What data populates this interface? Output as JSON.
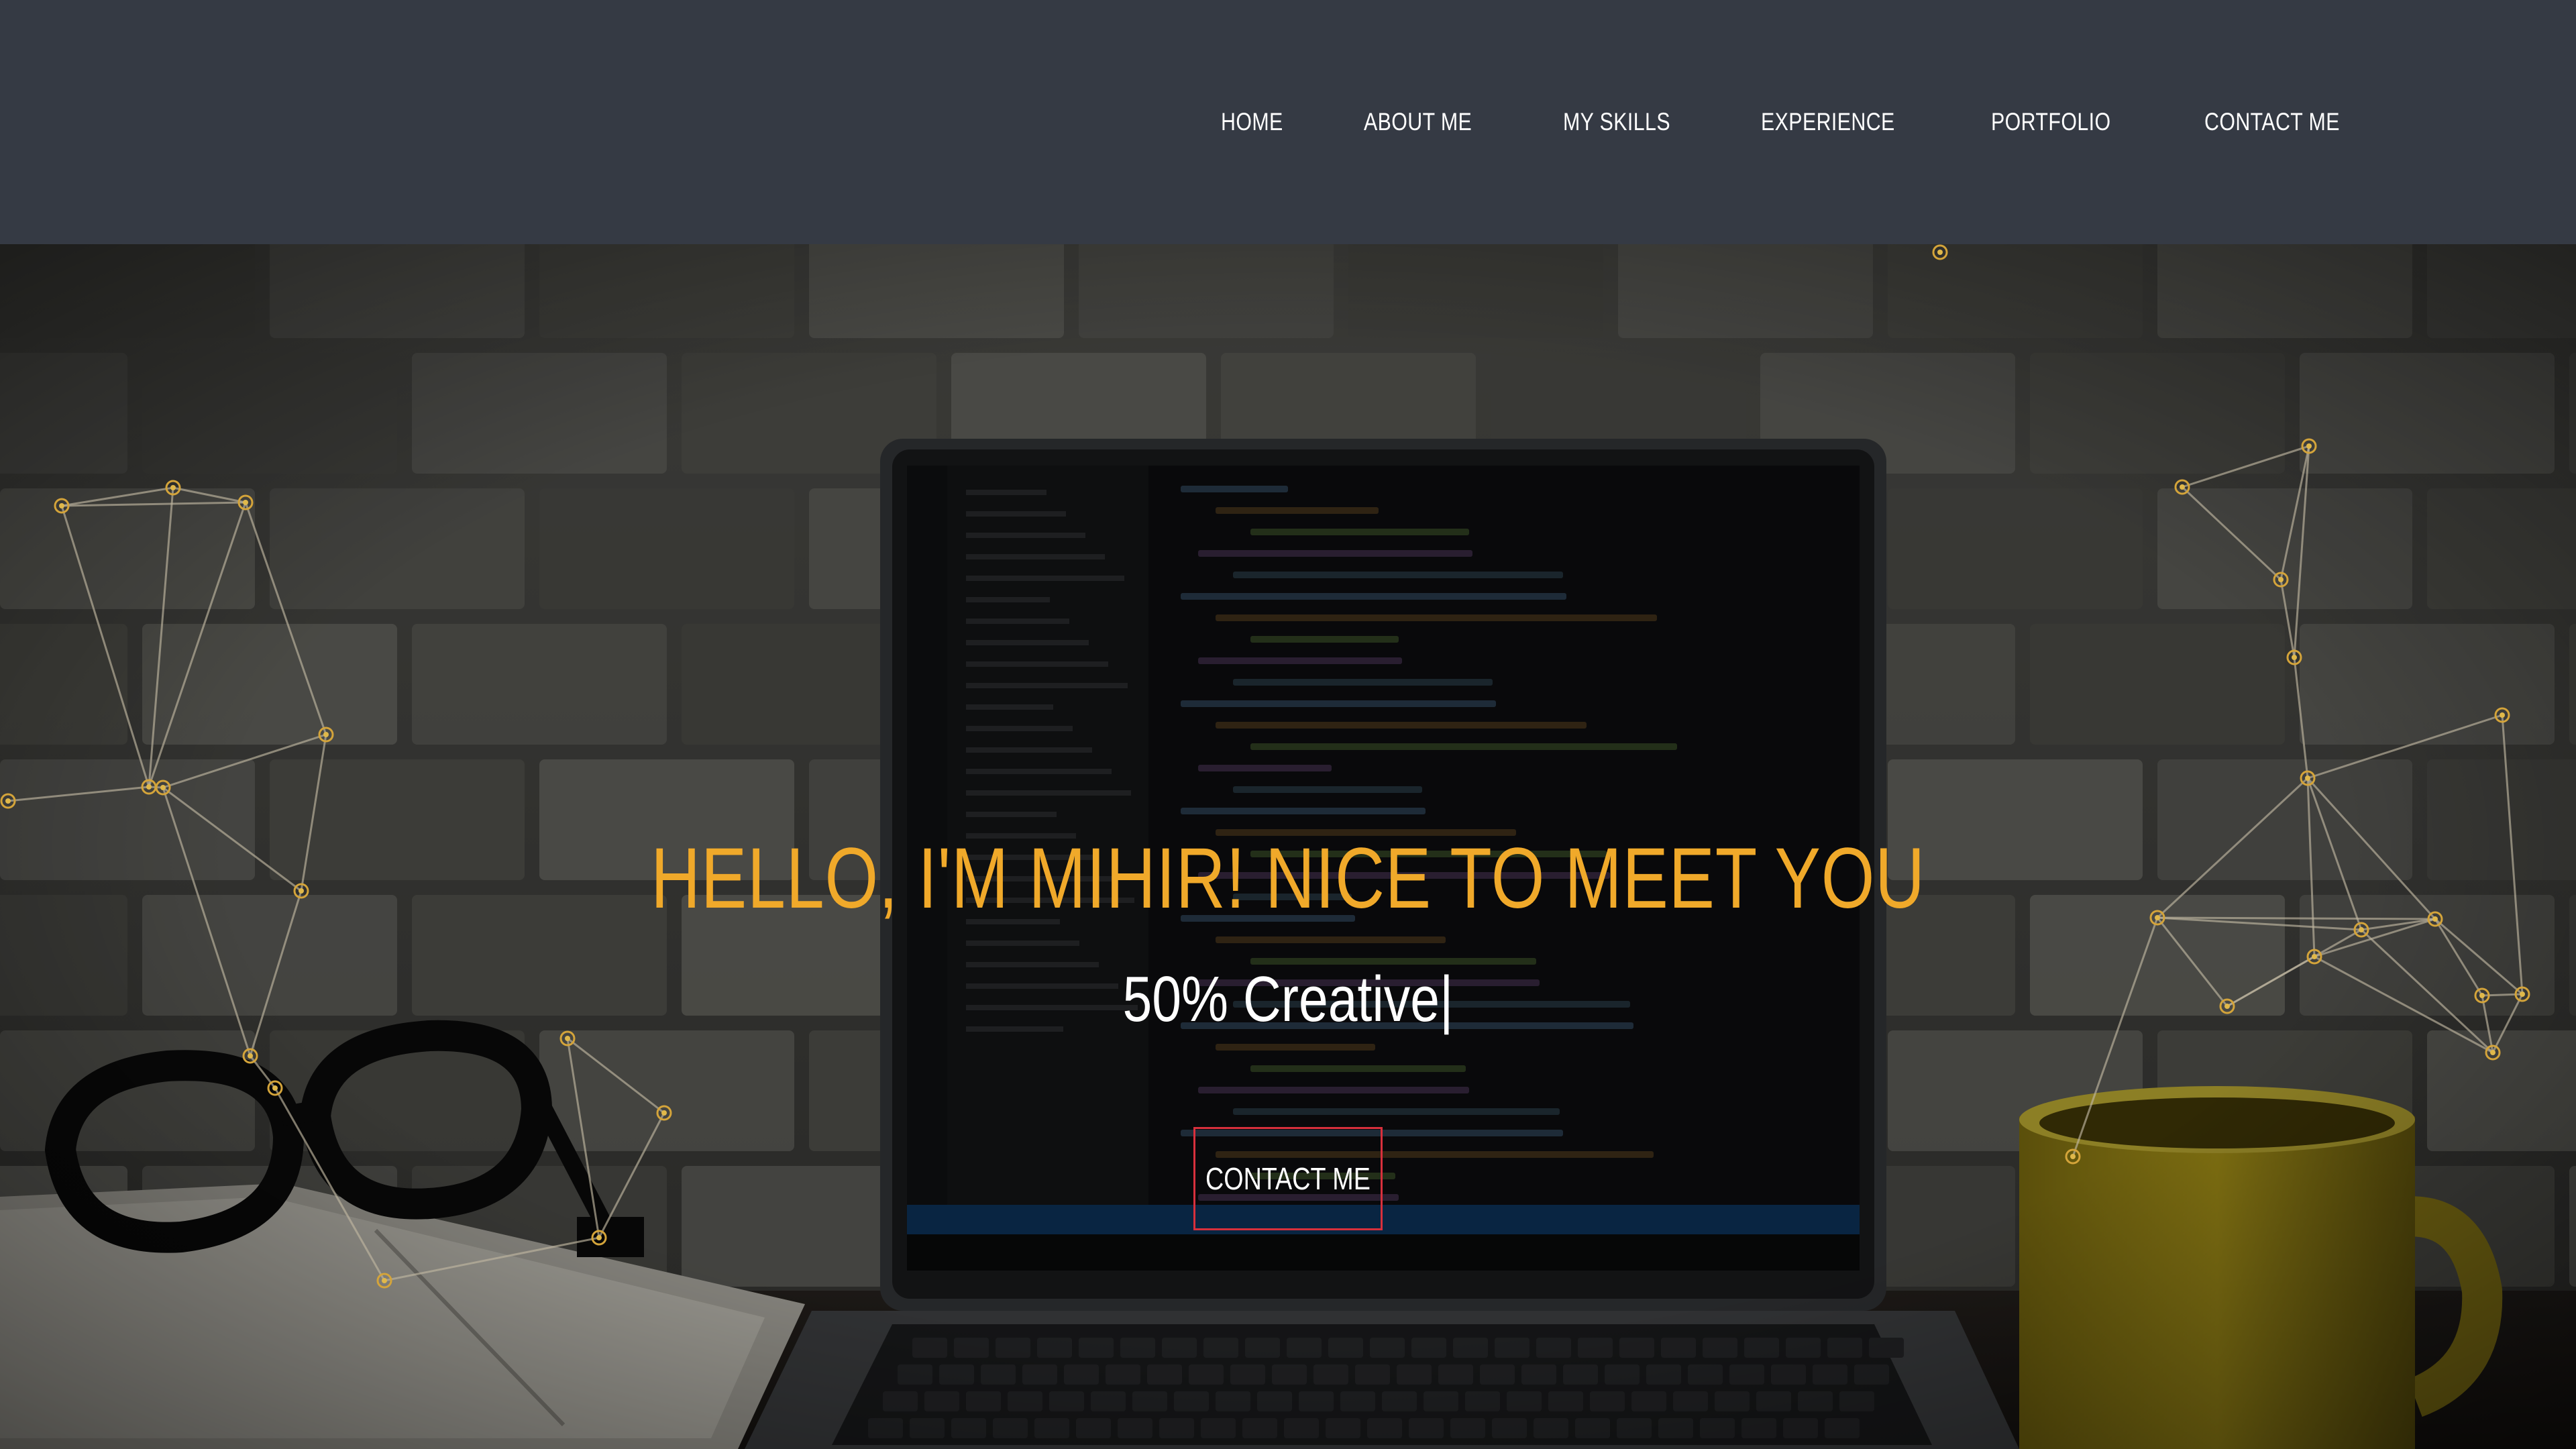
{
  "nav": {
    "items": [
      {
        "label": "HOME"
      },
      {
        "label": "ABOUT ME"
      },
      {
        "label": "MY SKILLS"
      },
      {
        "label": "EXPERIENCE"
      },
      {
        "label": "PORTFOLIO"
      },
      {
        "label": "CONTACT ME"
      }
    ]
  },
  "hero": {
    "title": "HELLO, I'M MIHIR! NICE TO MEET YOU",
    "subtitle": "50% Creative",
    "cursor": "|",
    "cta_label": "CONTACT ME"
  },
  "colors": {
    "navbar": "#353a44",
    "accent": "#f0a92a",
    "cta_border": "#d7303c",
    "text": "#ffffff"
  }
}
